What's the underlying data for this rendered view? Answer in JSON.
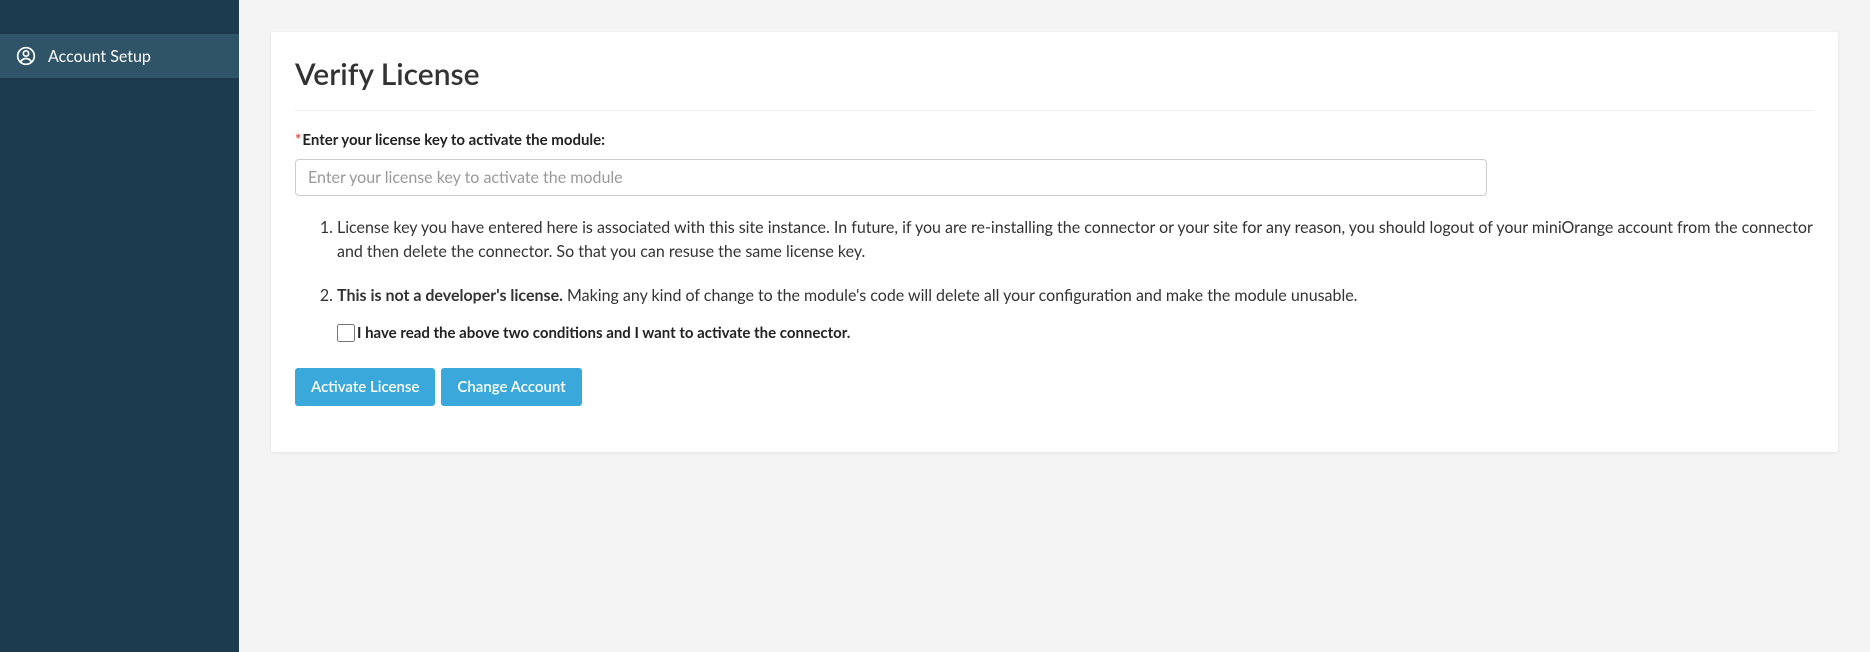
{
  "sidebar": {
    "items": [
      {
        "label": "Account Setup",
        "icon": "user-circle-icon"
      }
    ]
  },
  "main": {
    "title": "Verify License",
    "field": {
      "required_marker": "*",
      "label": "Enter your license key to activate the module:",
      "placeholder": "Enter your license key to activate the module",
      "value": ""
    },
    "notes": {
      "item1": "License key you have entered here is associated with this site instance. In future, if you are re-installing the connector or your site for any reason, you should logout of your miniOrange account from the connector and then delete the connector. So that you can resuse the same license key.",
      "item2_bold": "This is not a developer's license.",
      "item2_rest": " Making any kind of change to the module's code will delete all your configuration and make the module unusable."
    },
    "agree": {
      "label": "I have read the above two conditions and I want to activate the connector.",
      "checked": false
    },
    "buttons": {
      "activate": "Activate License",
      "change": "Change Account"
    }
  }
}
